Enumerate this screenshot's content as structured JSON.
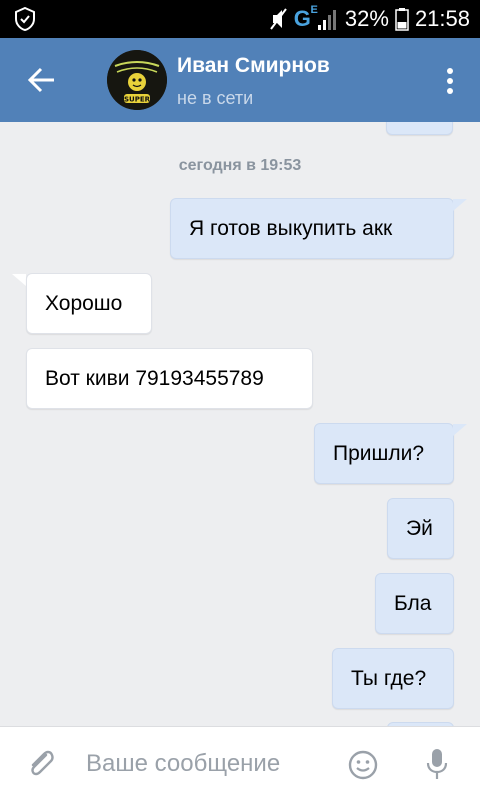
{
  "status_bar": {
    "network": "G",
    "network_sup": "E",
    "battery": "32%",
    "time": "21:58"
  },
  "header": {
    "title": "Иван Смирнов",
    "status": "не в сети"
  },
  "messages": {
    "date_separator": "сегодня в 19:53",
    "items": [
      {
        "text": "Я готов выкупить акк",
        "direction": "out"
      },
      {
        "text": "Хорошо",
        "direction": "in"
      },
      {
        "text": "Вот киви 79193455789",
        "direction": "in"
      },
      {
        "text": "Пришли?",
        "direction": "out"
      },
      {
        "text": "Эй",
        "direction": "out"
      },
      {
        "text": "Бла",
        "direction": "out"
      },
      {
        "text": "Ты где?",
        "direction": "out"
      }
    ]
  },
  "composer": {
    "placeholder": "Ваше сообщение"
  },
  "colors": {
    "header_bg": "#5181b8",
    "chat_bg": "#edeef0",
    "outgoing_bubble": "#dbe7f8",
    "incoming_bubble": "#ffffff"
  }
}
